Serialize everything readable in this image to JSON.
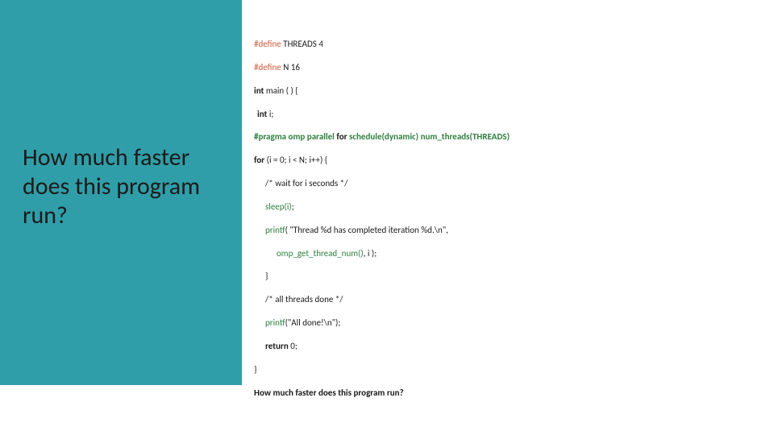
{
  "title": "How much faster does this program run?",
  "code": {
    "l1": {
      "a": "#define",
      "b": " THREADS 4"
    },
    "l2": {
      "a": "#define",
      "b": " N 16"
    },
    "l3": {
      "a": "int",
      "b": " main ( ) {"
    },
    "l4": {
      "a": "int",
      "b": " i;"
    },
    "l5": {
      "a": "#pragma omp parallel",
      "b": "for",
      "c": "schedule(dynamic)",
      "d": "num_threads(THREADS)"
    },
    "l6": {
      "a": "for",
      "b": " (i = 0; i < N; i++)  {"
    },
    "l7": "/* wait for i seconds */",
    "l8": {
      "a": "sleep(i)",
      "b": ";"
    },
    "l9": {
      "a": "printf",
      "b": "( \"Thread %d has completed iteration %d.\\n\","
    },
    "l10": {
      "a": "omp_get_thread_num()",
      "b": ", i );"
    },
    "l11": "}",
    "l12": "/* all threads done */",
    "l13": {
      "a": "printf",
      "b": "(\"All done!\\n\");"
    },
    "l14": {
      "a": "return",
      "b": " 0;"
    },
    "l15": "}",
    "l16": "How much faster does this program run?"
  }
}
